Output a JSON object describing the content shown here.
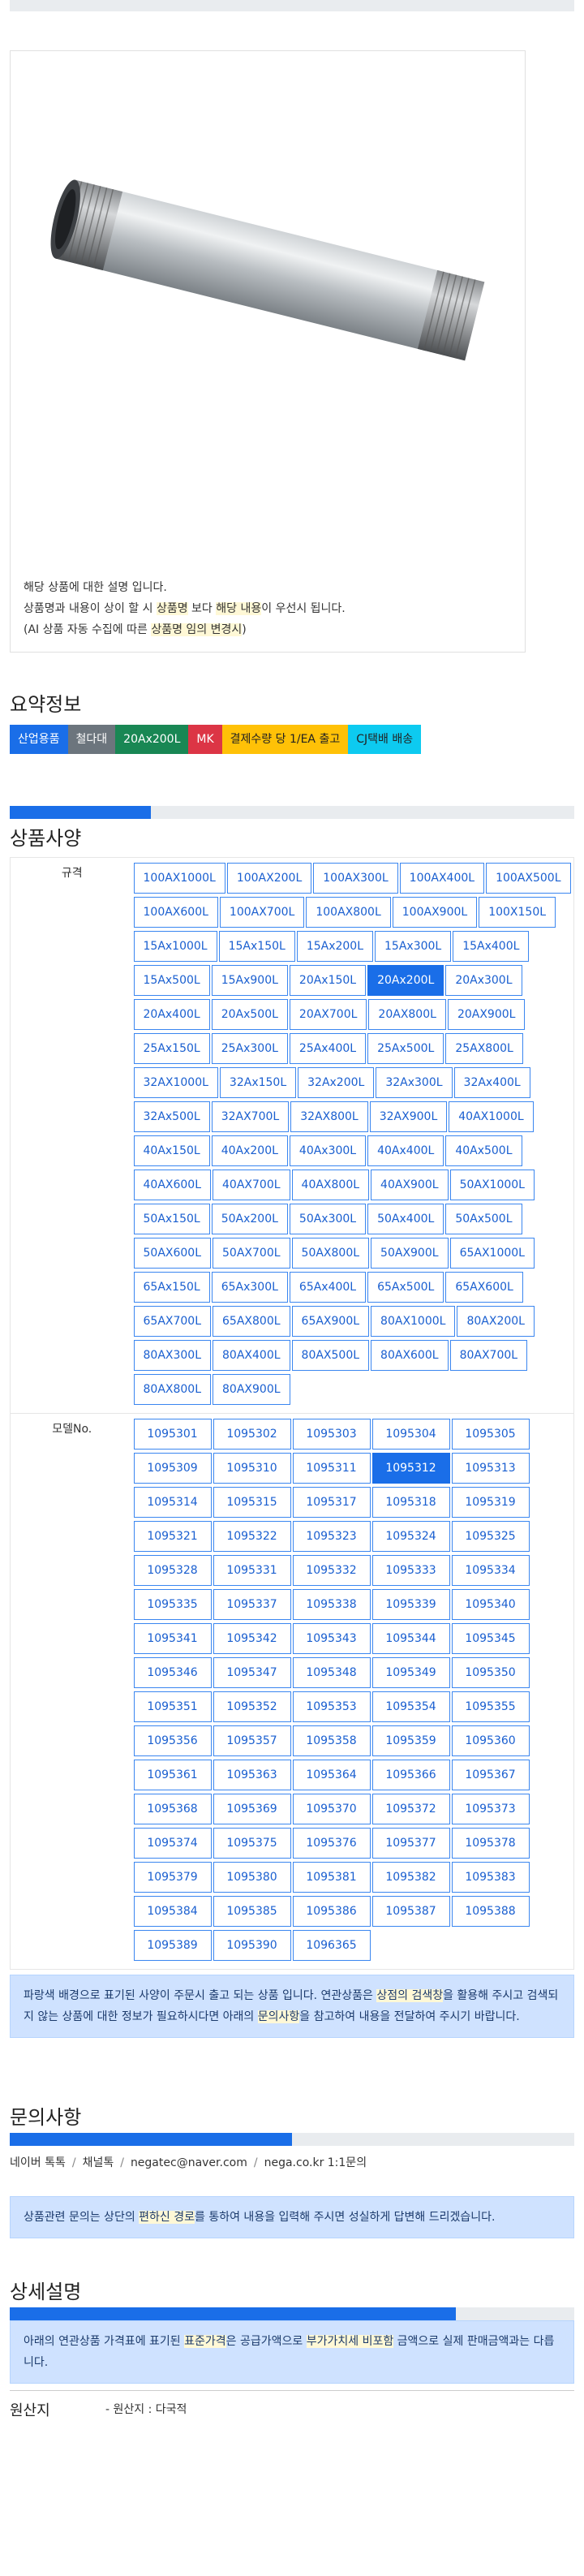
{
  "product": {
    "image_alt": "galvanized steel nipple pipe",
    "desc_line1": "해당 상품에 대한 설명 입니다.",
    "desc_line2_parts": [
      "상품명과 내용이 상이 할 시 ",
      "상품명",
      " 보다 ",
      "해당 내용",
      "이 우선시 됩니다."
    ],
    "desc_line3_parts": [
      "(AI 상품 자동 수집에 따른 ",
      "상품명 임의 변경시",
      ")"
    ]
  },
  "summary": {
    "title": "요약정보",
    "badges": [
      {
        "label": "산업용품",
        "color": "#1a6ee8"
      },
      {
        "label": "철다대",
        "color": "#6c757d"
      },
      {
        "label": "20Ax200L",
        "color": "#198754"
      },
      {
        "label": "MK",
        "color": "#dc3545"
      },
      {
        "label": "결제수량 당 1/EA 출고",
        "color": "#ffc107",
        "text": "#222"
      },
      {
        "label": "CJ택배 배송",
        "color": "#0dcaf0",
        "text": "#222"
      }
    ]
  },
  "spec": {
    "title": "상품사양",
    "progress": 0.25,
    "size_label": "규격",
    "sizes": [
      "100AX1000L",
      "100AX200L",
      "100AX300L",
      "100AX400L",
      "100AX500L",
      "100AX600L",
      "100AX700L",
      "100AX800L",
      "100AX900L",
      "100X150L",
      "15Ax1000L",
      "15Ax150L",
      "15Ax200L",
      "15Ax300L",
      "15Ax400L",
      "15Ax500L",
      "15Ax900L",
      "20Ax150L",
      "20Ax200L",
      "20Ax300L",
      "20Ax400L",
      "20Ax500L",
      "20AX700L",
      "20AX800L",
      "20AX900L",
      "25Ax150L",
      "25Ax300L",
      "25Ax400L",
      "25Ax500L",
      "25AX800L",
      "32AX1000L",
      "32Ax150L",
      "32Ax200L",
      "32Ax300L",
      "32Ax400L",
      "32Ax500L",
      "32AX700L",
      "32AX800L",
      "32AX900L",
      "40AX1000L",
      "40Ax150L",
      "40Ax200L",
      "40Ax300L",
      "40Ax400L",
      "40Ax500L",
      "40AX600L",
      "40AX700L",
      "40AX800L",
      "40AX900L",
      "50AX1000L",
      "50Ax150L",
      "50Ax200L",
      "50Ax300L",
      "50Ax400L",
      "50Ax500L",
      "50AX600L",
      "50AX700L",
      "50AX800L",
      "50AX900L",
      "65AX1000L",
      "65Ax150L",
      "65Ax300L",
      "65Ax400L",
      "65Ax500L",
      "65AX600L",
      "65AX700L",
      "65AX800L",
      "65AX900L",
      "80AX1000L",
      "80AX200L",
      "80AX300L",
      "80AX400L",
      "80AX500L",
      "80AX600L",
      "80AX700L",
      "80AX800L",
      "80AX900L"
    ],
    "selected_size": "20Ax200L",
    "model_label": "모델No.",
    "models": [
      "1095301",
      "1095302",
      "1095303",
      "1095304",
      "1095305",
      "1095309",
      "1095310",
      "1095311",
      "1095312",
      "1095313",
      "1095314",
      "1095315",
      "1095317",
      "1095318",
      "1095319",
      "1095321",
      "1095322",
      "1095323",
      "1095324",
      "1095325",
      "1095328",
      "1095331",
      "1095332",
      "1095333",
      "1095334",
      "1095335",
      "1095337",
      "1095338",
      "1095339",
      "1095340",
      "1095341",
      "1095342",
      "1095343",
      "1095344",
      "1095345",
      "1095346",
      "1095347",
      "1095348",
      "1095349",
      "1095350",
      "1095351",
      "1095352",
      "1095353",
      "1095354",
      "1095355",
      "1095356",
      "1095357",
      "1095358",
      "1095359",
      "1095360",
      "1095361",
      "1095363",
      "1095364",
      "1095366",
      "1095367",
      "1095368",
      "1095369",
      "1095370",
      "1095372",
      "1095373",
      "1095374",
      "1095375",
      "1095376",
      "1095377",
      "1095378",
      "1095379",
      "1095380",
      "1095381",
      "1095382",
      "1095383",
      "1095384",
      "1095385",
      "1095386",
      "1095387",
      "1095388",
      "1095389",
      "1095390",
      "1096365"
    ],
    "selected_model": "1095312",
    "notice_parts": [
      "파랑색 배경으로 표기된 사양이 주문시 출고 되는 상품 입니다. 연관상품은 ",
      "상점의 검색창",
      "을 활용해 주시고 검색되지 않는 상품에 대한 정보가 필요하시다면 아래의 ",
      "문의사항",
      "을 참고하여 내용을 전달하여 주시기 바랍니다."
    ]
  },
  "inquiry": {
    "title": "문의사항",
    "progress": 0.5,
    "links": [
      "네이버 톡톡",
      "채널톡",
      "negatec@naver.com",
      "nega.co.kr 1:1문의"
    ],
    "notice_parts": [
      "상품관련 문의는 상단의 ",
      "편하신 경로",
      "를 통하여 내용을 입력해 주시면 성실하게 답변해 드리겠습니다."
    ]
  },
  "detail": {
    "title": "상세설명",
    "progress": 0.79,
    "notice_parts": [
      "아래의 연관상품 가격표에 표기된 ",
      "표준가격",
      "은 공급가액으로 ",
      "부가가치세 비포함",
      " 금액으로 실제 판매금액과는 다릅니다."
    ]
  },
  "origin": {
    "label": "원산지",
    "value": "- 원산지 : 다국적"
  }
}
